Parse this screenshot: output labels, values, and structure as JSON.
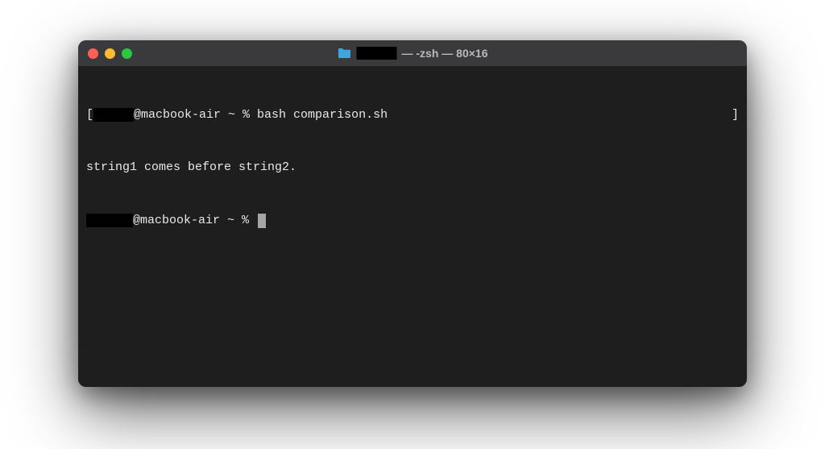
{
  "titlebar": {
    "title_suffix": " — -zsh — 80×16"
  },
  "terminal": {
    "line1_prefix": "[",
    "line1_mid": "@macbook-air ~ % ",
    "line1_cmd": "bash comparison.sh",
    "line1_suffix": "]",
    "line2": "string1 comes before string2.",
    "line3_mid": "@macbook-air ~ % "
  }
}
